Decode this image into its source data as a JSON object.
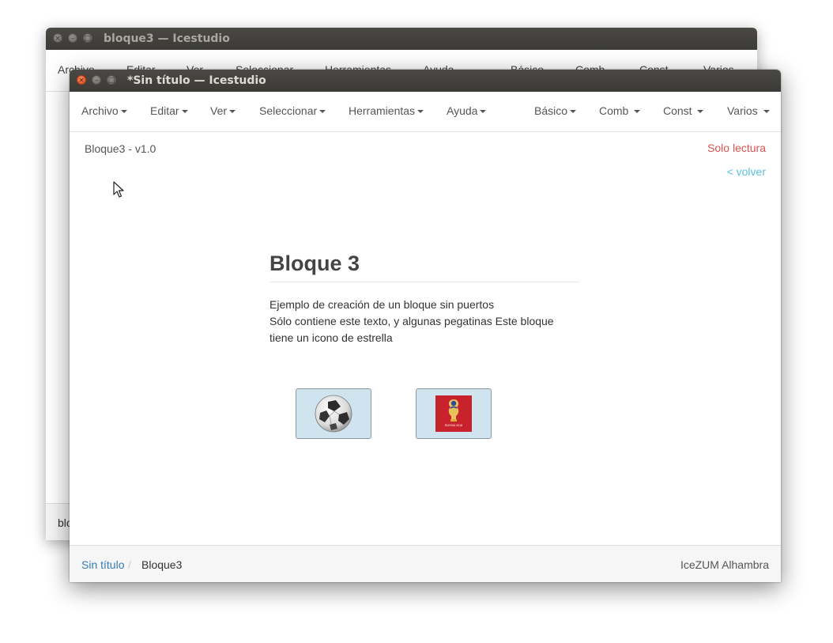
{
  "back_window": {
    "title": "bloque3 — Icestudio",
    "menu": [
      "Archivo",
      "Editar",
      "Ver",
      "Seleccionar",
      "Herramientas",
      "Ayuda",
      "Básico",
      "Comb",
      "Const",
      "Varios"
    ],
    "status_text": "blo"
  },
  "front_window": {
    "title": "*Sin título — Icestudio",
    "menu": {
      "archivo": "Archivo",
      "editar": "Editar",
      "ver": "Ver",
      "seleccionar": "Seleccionar",
      "herramientas": "Herramientas",
      "ayuda": "Ayuda",
      "basico": "Básico",
      "comb": "Comb",
      "const": "Const",
      "varios": "Varios"
    }
  },
  "header": {
    "block_version": "Bloque3 - v1.0",
    "readonly": "Solo lectura",
    "back": "< volver"
  },
  "block": {
    "title": "Bloque 3",
    "description_lines": [
      "Ejemplo de creación de un bloque sin puertos",
      "Sólo contiene este texto, y algunas pegatinas Este bloque",
      "tiene un icono de estrella"
    ],
    "stickers": [
      {
        "name": "football-ball-icon"
      },
      {
        "name": "world-cup-russia-2018-logo",
        "text": "RUSSIA 2018"
      }
    ]
  },
  "footer": {
    "breadcrumb_root": "Sin título",
    "breadcrumb_current": "Bloque3",
    "board": "IceZUM Alhambra"
  },
  "colors": {
    "titlebar": "#3b3a36",
    "readonly": "#d9534f",
    "back_link": "#5bc0de",
    "link": "#337ab7",
    "sticker_bg": "#cfe4ef"
  }
}
